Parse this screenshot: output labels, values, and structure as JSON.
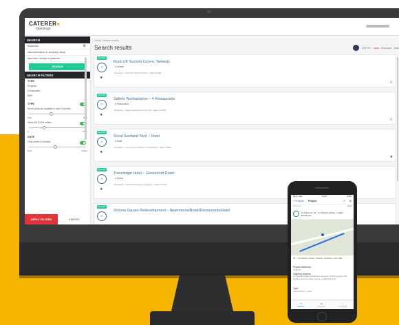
{
  "app": {
    "brand": "CATERER",
    "brand_sub": "Openings"
  },
  "sidebar": {
    "section_search": "SEARCH",
    "search_row1": "Keywords",
    "search_row2": "Add information or company name",
    "search_row3": "Add town, county or postcode",
    "search_button": "SEARCH",
    "section_filters": "SEARCH FILTERS",
    "type_label": "TYPE",
    "type_items": [
      "Projects",
      "Companies",
      "Both"
    ],
    "group1_label": "TYPE",
    "group1_text": "Show projects updated in last 3 months",
    "range1": [
      "Past",
      "New"
    ],
    "group2_text": "Value £0-£10M million",
    "range2": [
      "0",
      "Large"
    ],
    "group3_label": "DATE",
    "group3_text": "Only within 6 months",
    "range3": [
      "Now",
      "Future"
    ],
    "apply_button": "APPLY FILTERS",
    "cancel_button": "CANCEL"
  },
  "main": {
    "breadcrumb": "Home  /  Search results",
    "title": "Search results",
    "sort_label": "SORT BY",
    "sort_options": [
      "Latest",
      "Relevance",
      "Value"
    ],
    "results": [
      {
        "badge": "Jan 2017",
        "title": "Rock UK Summit Centre, Tarleeds",
        "sub": "Leisure",
        "meta": "Developer · Rock UK Summit Centre · Value: £13M"
      },
      {
        "badge": "Jan 2017",
        "title": "Saferlo Northampton – 4 Restaurants",
        "sub": "Restaurants",
        "meta": "Developer · Aegis Investment Group Ltd · Value: £1.25M"
      },
      {
        "badge": "Jan 2017",
        "title": "Great Scotland Yard – Hotel",
        "sub": "Hotel",
        "meta": "Developer · Lucy Group (Northern Investments) · Value: £39M"
      },
      {
        "badge": "Jan 2017",
        "title": "Travelodge Hotel – Goosecroft Road",
        "sub": "Dining",
        "meta": "Developer · Sherwood Property Company · Value: £3.4M"
      },
      {
        "badge": "Jan 2017",
        "title": "Victoria Square Redevelopment – Apartments/Retail/Restaurants/Hotel",
        "sub": "",
        "meta": ""
      }
    ]
  },
  "phone": {
    "status_left": "●●●○○ EE",
    "status_time": "10:00",
    "status_right": "100%",
    "back_label": "< Projects",
    "title": "Project",
    "prev_label": "Previous",
    "next_label": "Next",
    "card_text": "La Pasiones, 25 – 27 Paulines Street – Indian Restaurant",
    "address": "25 – 27 Paulines Street, Chester, Cheshire, CH1 2AB",
    "sec1": "Project reference",
    "val1": "12345/67",
    "sec2": "Catering scheme",
    "long2": "La Pasiones Indian restaurant comprising 70 dining covers with ancillary accommodation and an outstanding view",
    "sec3": "Type",
    "val3": "Casual Dining · Indian",
    "tabs": [
      "Search",
      "Projects",
      "Contacts"
    ]
  },
  "colors": {
    "accent_green": "#20c997",
    "brand_yellow": "#f5b400",
    "link_blue": "#3b6c9b",
    "danger_red": "#e0353b"
  }
}
